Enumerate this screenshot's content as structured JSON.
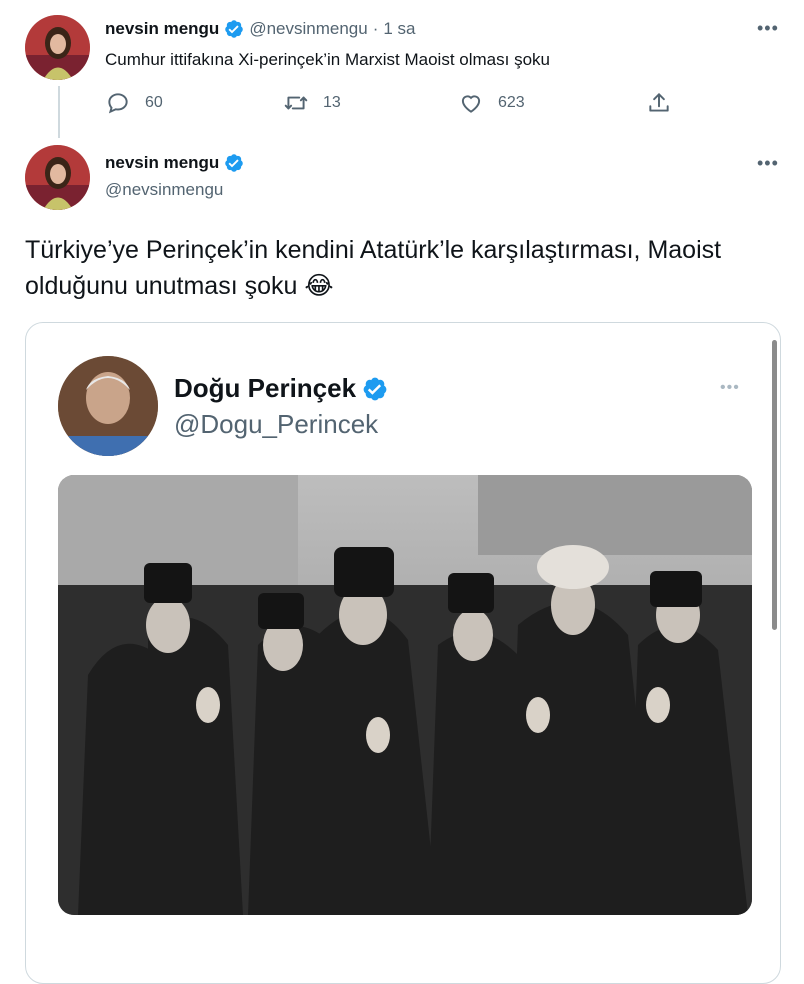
{
  "tweet1": {
    "display_name": "nevsin mengu",
    "handle": "@nevsinmengu",
    "separator": "·",
    "time": "1 sa",
    "text": "Cumhur ittifakına Xi-perinçek’in Marxist Maoist olması şoku",
    "reply_count": "60",
    "retweet_count": "13",
    "like_count": "623"
  },
  "tweet2": {
    "display_name": "nevsin mengu",
    "handle": "@nevsinmengu",
    "text": "Türkiye’ye Perinçek’in kendini Atatürk’le karşılaştırması, Maoist olduğunu unutması şoku 😂"
  },
  "embedded": {
    "display_name": "Doğu Perinçek",
    "handle": "@Dogu_Perincek"
  },
  "icons": {
    "verified_color": "#1d9bf0"
  }
}
